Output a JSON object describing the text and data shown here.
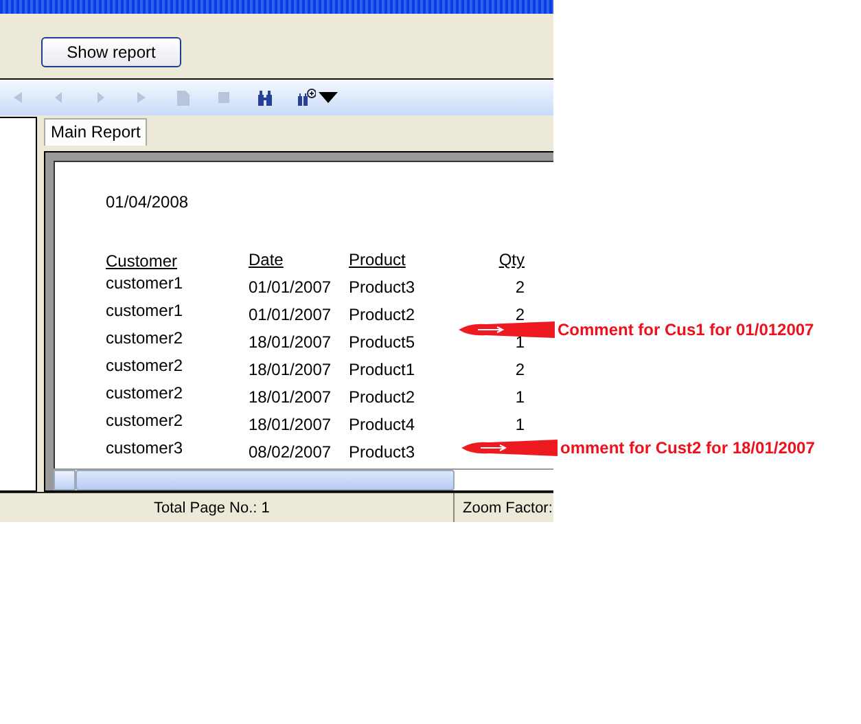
{
  "form": {
    "button": "Show report"
  },
  "toolbar": [
    {
      "kind": "first",
      "disabled": true
    },
    {
      "kind": "prev",
      "disabled": true
    },
    {
      "kind": "next",
      "disabled": true
    },
    {
      "kind": "last",
      "disabled": true
    },
    {
      "kind": "export",
      "disabled": true
    },
    {
      "kind": "stop",
      "disabled": true
    },
    {
      "kind": "find",
      "disabled": false
    },
    {
      "kind": "zoom",
      "disabled": false
    }
  ],
  "tabs": [
    {
      "label": "Main Report",
      "selected": true
    }
  ],
  "report": {
    "date": "01/04/2008",
    "columns": [
      "Customer",
      "Date",
      "Product",
      "Qty"
    ],
    "rows": [
      {
        "customer": "customer1",
        "date": "01/01/2007",
        "product": "Product3",
        "qty": "2"
      },
      {
        "customer": "customer1",
        "date": "01/01/2007",
        "product": "Product2",
        "qty": "2"
      },
      {
        "customer": "customer2",
        "date": "18/01/2007",
        "product": "Product5",
        "qty": "1"
      },
      {
        "customer": "customer2",
        "date": "18/01/2007",
        "product": "Product1",
        "qty": "2"
      },
      {
        "customer": "customer2",
        "date": "18/01/2007",
        "product": "Product2",
        "qty": "1"
      },
      {
        "customer": "customer2",
        "date": "18/01/2007",
        "product": "Product4",
        "qty": "1"
      },
      {
        "customer": "customer3",
        "date": "08/02/2007",
        "product": "Product3"
      }
    ]
  },
  "status_bar": [
    "Total Page No.: 1",
    "Zoom Factor:"
  ],
  "annotations": [
    {
      "text": "Comment for Cus1 for 01/012007"
    },
    {
      "text": "omment for Cust2 for 18/01/2007"
    }
  ]
}
